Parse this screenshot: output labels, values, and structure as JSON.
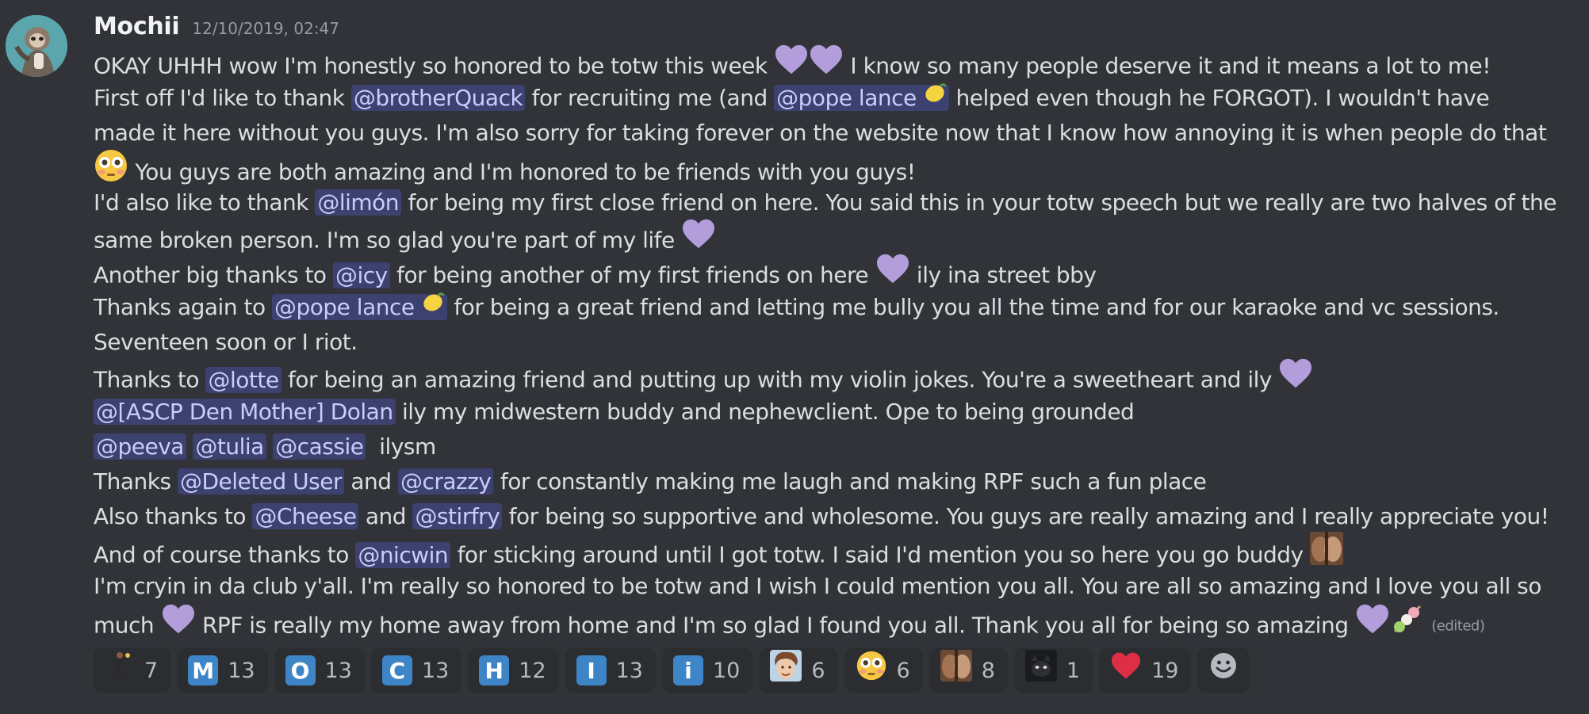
{
  "message": {
    "username": "Mochii",
    "timestamp": "12/10/2019, 02:47",
    "edited_label": "(edited)"
  },
  "lines": {
    "l1": {
      "a": "OKAY UHHH wow I'm honestly so honored to be totw this week",
      "b": " I know so many people deserve it and it means a lot to me!"
    },
    "l2": {
      "a": "First off I'd like to thank ",
      "m1": "@brotherQuack",
      "b": " for recruiting me (and ",
      "m2": "@pope lance",
      "c": " helped even though he FORGOT). I wouldn't have"
    },
    "l3": {
      "a": "made it here without you guys. I'm also sorry for taking forever on the website now that I know how annoying it is when people do that"
    },
    "l4": {
      "a": " You guys are both amazing and I'm honored to be friends with you guys!"
    },
    "l5": {
      "a": "I'd also like to thank ",
      "m1": "@limón",
      "b": " for being my first close friend on here. You said this in your totw speech but we really are two halves of the"
    },
    "l6": {
      "a": "same broken person. I'm so glad you're part of my life "
    },
    "l7": {
      "a": "Another big thanks to ",
      "m1": "@icy",
      "b": " for being another of my first friends on here ",
      "c": " ily ina street bby"
    },
    "l8": {
      "a": "Thanks again to ",
      "m1": "@pope lance",
      "b": " for being a great friend and letting me bully you all the time and for our karaoke and vc sessions."
    },
    "l9": {
      "a": "Seventeen soon or I riot."
    },
    "l10": {
      "a": "Thanks to ",
      "m1": "@lotte",
      "b": " for being an amazing friend and putting up with my violin jokes. You're a sweetheart and ily "
    },
    "l11": {
      "m1": "@[ASCP Den Mother] Dolan",
      "a": " ily my midwestern buddy and nephewclient. Ope to being grounded"
    },
    "l12": {
      "m1": "@peeva",
      "m2": "@tulia",
      "m3": "@cassie",
      "a": "  ilysm"
    },
    "l13": {
      "a": "Thanks ",
      "m1": "@Deleted User",
      "b": " and ",
      "m2": "@crazzy",
      "c": " for constantly making me laugh and making RPF such a fun place"
    },
    "l14": {
      "a": "Also thanks to ",
      "m1": "@Cheese",
      "b": " and ",
      "m2": "@stirfry",
      "c": " for being so supportive and wholesome. You guys are really amazing and I really appreciate you!"
    },
    "l15": {
      "a": "And of course thanks to ",
      "m1": "@nicwin",
      "b": " for sticking around until I got totw. I said I'd mention you so here you go buddy "
    },
    "l16": {
      "a": "I'm cryin in da club y'all. I'm really so honored to be totw and I wish I could mention you all. You are all so amazing and I love you all so"
    },
    "l17": {
      "a": "much ",
      "b": " RPF is really my home away from home and I'm so glad I found you all. Thank you all for being so amazing "
    }
  },
  "reactions": [
    {
      "icon": "dancer-icon",
      "count": "7"
    },
    {
      "letter": "M",
      "count": "13"
    },
    {
      "letter": "O",
      "count": "13"
    },
    {
      "letter": "C",
      "count": "13"
    },
    {
      "letter": "H",
      "count": "12"
    },
    {
      "letter": "I",
      "count": "13"
    },
    {
      "letter": "i",
      "count": "10"
    },
    {
      "icon": "face-photo-icon",
      "count": "6"
    },
    {
      "icon": "flushed-face-icon",
      "count": "6"
    },
    {
      "icon": "kiss-photo-icon",
      "count": "8"
    },
    {
      "icon": "dark-photo-icon",
      "count": "1"
    },
    {
      "icon": "heart-icon",
      "count": "19"
    }
  ],
  "colors": {
    "background": "#313338",
    "mention_bg": "#3c4270",
    "mention_text": "#c9cdfb",
    "heart_purple": "#b39ddb",
    "reaction_bg": "#2b2d31",
    "letter_box": "#3d85c6"
  }
}
